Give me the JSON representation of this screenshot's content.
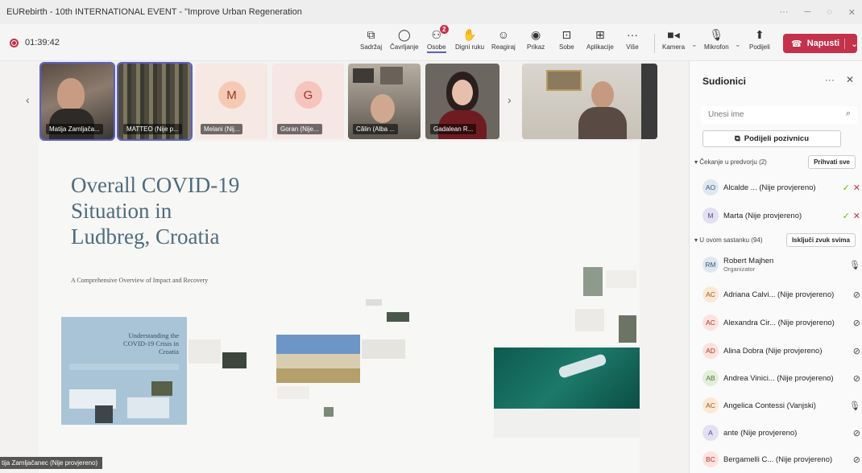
{
  "window": {
    "title": "EURebirth - 10th INTERNATIONAL EVENT - \"Improve Urban Regeneration",
    "controls": [
      "···",
      "─",
      "◌",
      "✕"
    ]
  },
  "toolbar": {
    "timer": "01:39:42",
    "buttons": [
      {
        "label": "Sadržaj",
        "icon": "share-content-icon"
      },
      {
        "label": "Čavrljanje",
        "icon": "chat-icon"
      },
      {
        "label": "Osobe",
        "icon": "people-icon",
        "badge": "2",
        "active": true
      },
      {
        "label": "Digni ruku",
        "icon": "raise-hand-icon"
      },
      {
        "label": "Reagiraj",
        "icon": "react-icon"
      },
      {
        "label": "Prikaz",
        "icon": "view-icon"
      },
      {
        "label": "Sobe",
        "icon": "rooms-icon"
      },
      {
        "label": "Aplikacije",
        "icon": "apps-icon"
      },
      {
        "label": "Više",
        "icon": "more-icon"
      }
    ],
    "kamera": "Kamera",
    "mikrofon": "Mikrofon",
    "podijeli": "Podijeli",
    "leave": "Napusti"
  },
  "video_strip": {
    "tiles": [
      {
        "name": "Matija Zamljača...",
        "type": "video",
        "selected": true
      },
      {
        "name": "MATTEO (Nije p...",
        "type": "video",
        "selected": true
      },
      {
        "name": "Melani (Nij...",
        "type": "avatar",
        "initial": "M"
      },
      {
        "name": "Goran (Nije...",
        "type": "avatar",
        "initial": "G"
      },
      {
        "name": "Călin (Alba ...",
        "type": "video"
      },
      {
        "name": "Gadalean R...",
        "type": "video"
      },
      {
        "name": "",
        "type": "video"
      }
    ]
  },
  "slide": {
    "title_lines": [
      "Overall COVID-19",
      "Situation in",
      "Ludbreg, Croatia"
    ],
    "subtitle": "A Comprehensive Overview of Impact and Recovery",
    "card_title": [
      "Understanding the",
      "COVID-19 Crisis in",
      "Croatia"
    ]
  },
  "presenter_label": "tija Zamljačanec (Nije provjereno)",
  "sidebar": {
    "title": "Sudionici",
    "search_placeholder": "Unesi ime",
    "share_invite": "Podijeli pozivnicu",
    "lobby_section": "Čekanje u predvorju (2)",
    "admit_all": "Prihvati sve",
    "lobby": [
      {
        "initials": "AO",
        "name": "Alcalde ... (Nije provjereno)",
        "color": "#dfe7ef"
      },
      {
        "initials": "M",
        "name": "Marta (Nije provjereno)",
        "color": "#e3e0f1"
      }
    ],
    "meeting_section": "U ovom sastanku (94)",
    "mute_all": "Isključi zvuk svima",
    "participants": [
      {
        "initials": "RM",
        "name": "Robert Majhen",
        "role": "Organizator",
        "mic": "on",
        "color": "#dfe7ef"
      },
      {
        "initials": "AC",
        "name": "Adriana Calvi... (Nije provjereno)",
        "mic": "off",
        "color": "#fbe9d6"
      },
      {
        "initials": "AC",
        "name": "Alexandra Cir... (Nije provjereno)",
        "mic": "off",
        "color": "#fde2dd"
      },
      {
        "initials": "AD",
        "name": "Alina Dobra (Nije provjereno)",
        "mic": "off",
        "color": "#fde2dd"
      },
      {
        "initials": "AB",
        "name": "Andrea Vinici... (Nije provjereno)",
        "mic": "off",
        "color": "#e3eedb"
      },
      {
        "initials": "AC",
        "name": "Angelica Contessi (Vanjski)",
        "mic": "on",
        "color": "#fbe9d6"
      },
      {
        "initials": "A",
        "name": "ante (Nije provjereno)",
        "mic": "off",
        "color": "#e3e0f1"
      },
      {
        "initials": "BC",
        "name": "Bergamelli C... (Nije provjereno)",
        "mic": "off",
        "color": "#fde2dd"
      }
    ]
  }
}
